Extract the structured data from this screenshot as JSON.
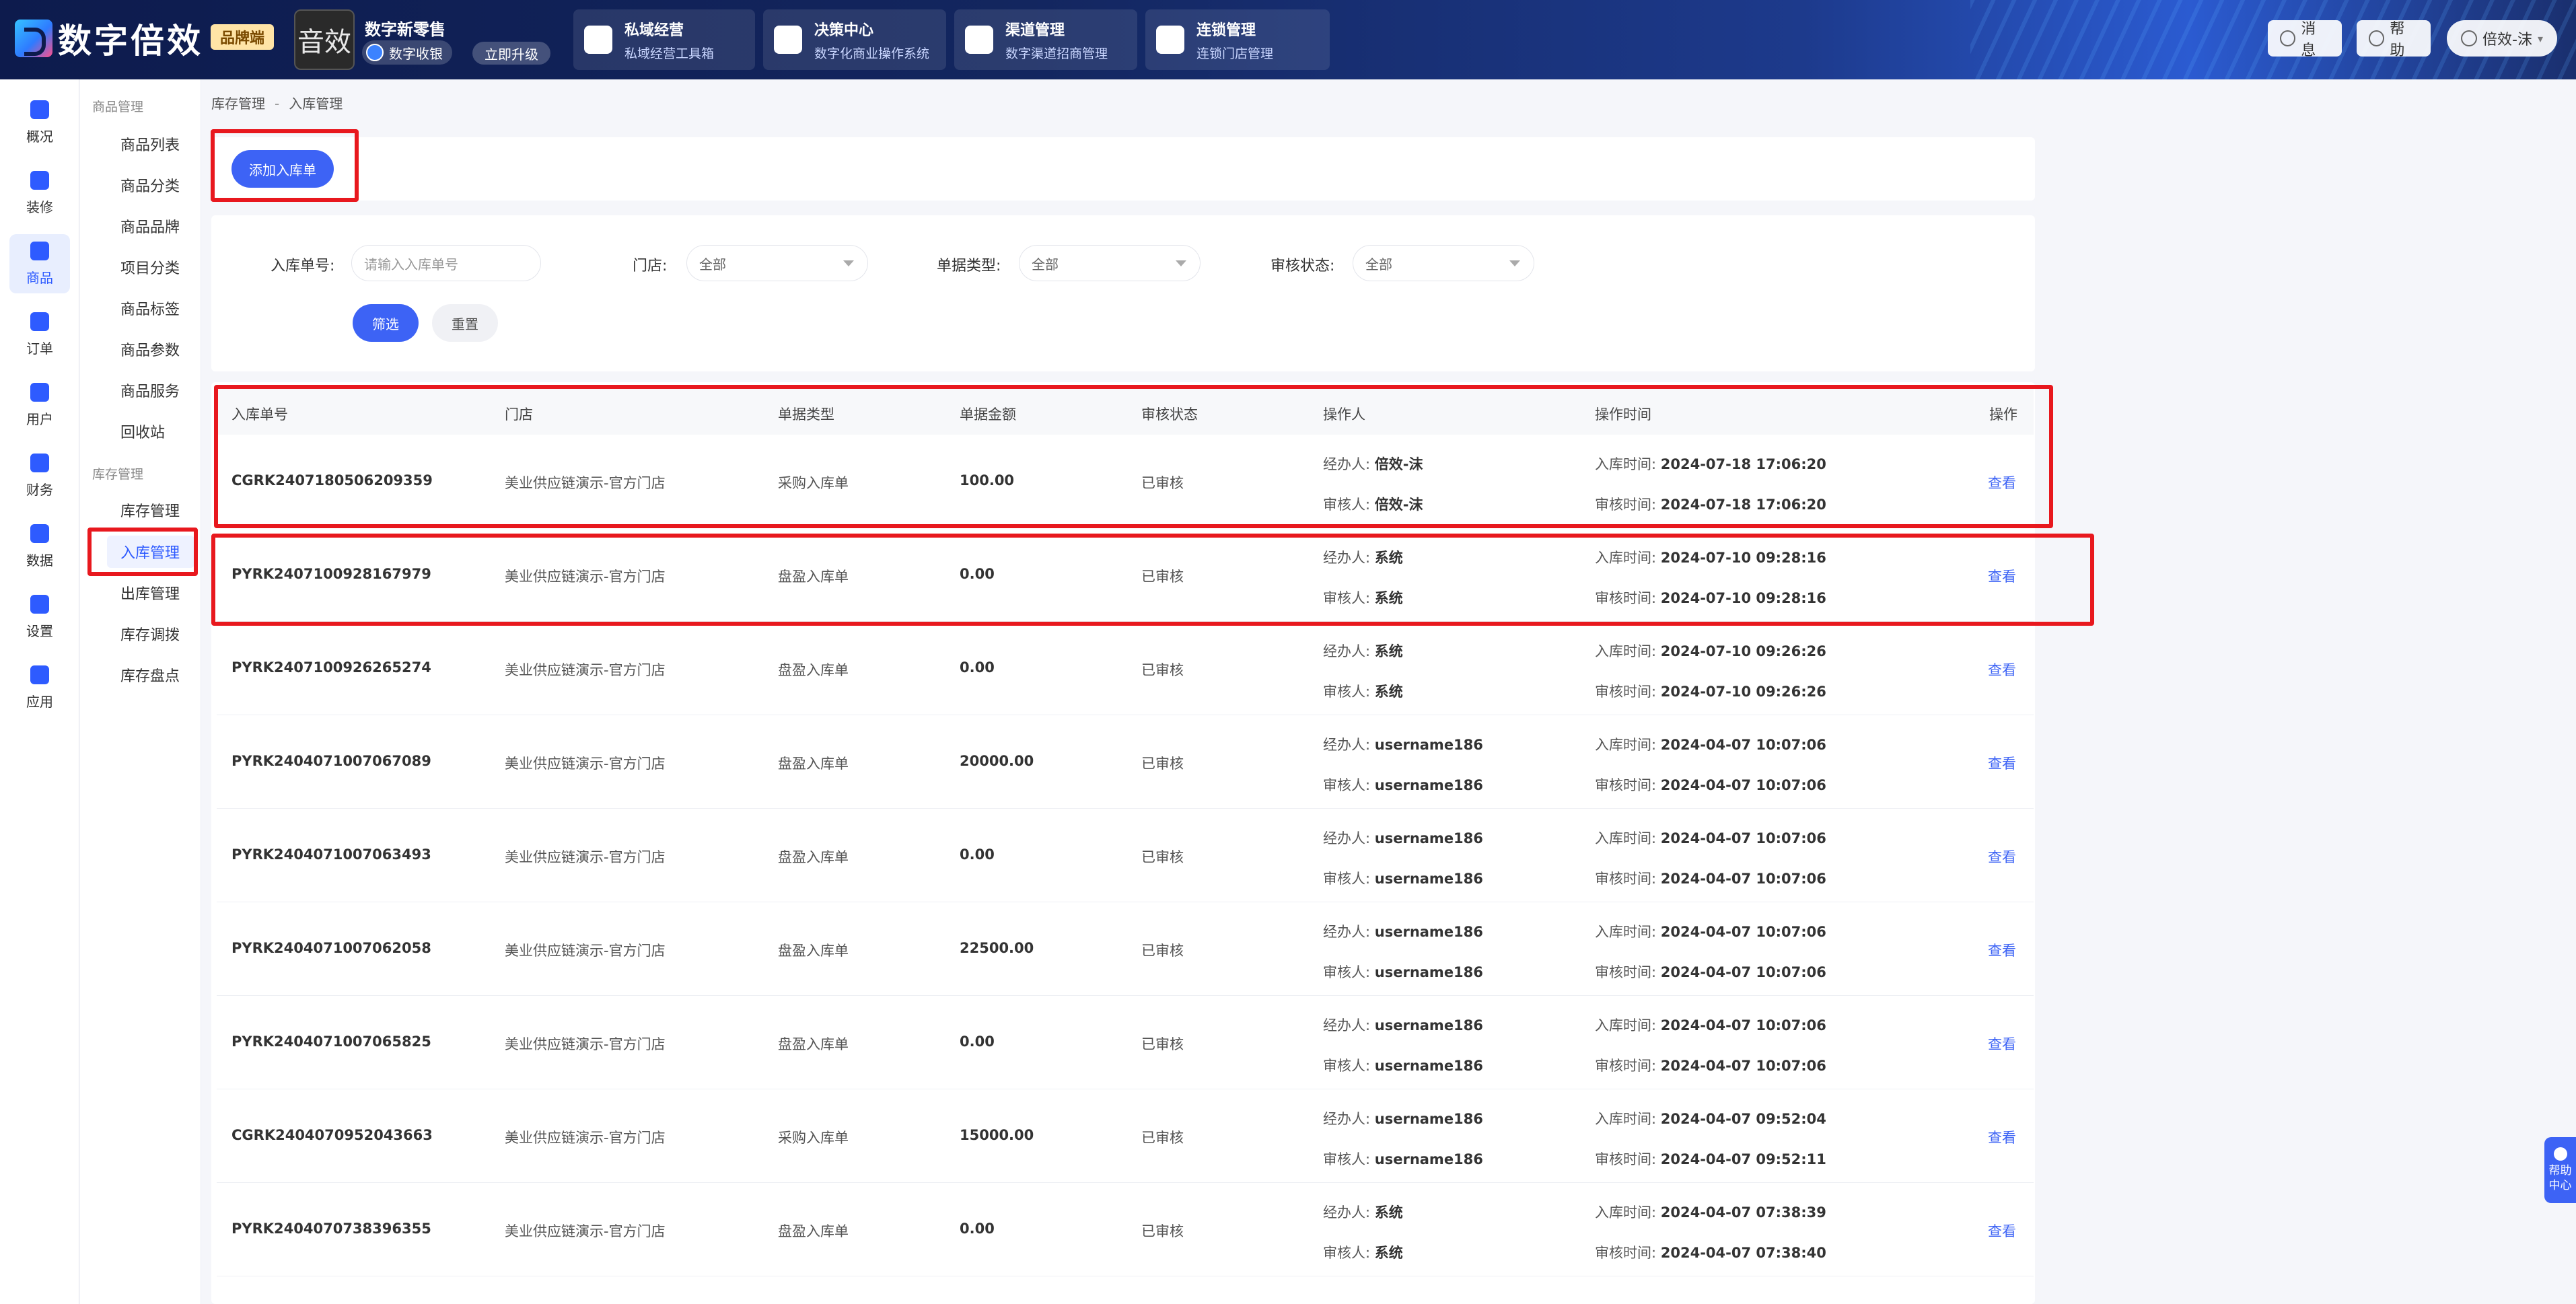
{
  "header": {
    "logo_text": "数字倍效",
    "edition": "品牌端",
    "store_avatar_text": "音效",
    "store_name": "数字新零售",
    "store_tag": "数字收银",
    "upgrade": "立即升级",
    "modules": [
      {
        "title": "私域经营",
        "sub": "私域经营工具箱"
      },
      {
        "title": "决策中心",
        "sub": "数字化商业操作系统"
      },
      {
        "title": "渠道管理",
        "sub": "数字渠道招商管理"
      },
      {
        "title": "连锁管理",
        "sub": "连锁门店管理"
      }
    ],
    "messages": "消息",
    "help": "帮助",
    "user": "倍效-沫"
  },
  "iconnav": [
    {
      "label": "概况",
      "icon": "overview-icon"
    },
    {
      "label": "装修",
      "icon": "decorate-icon"
    },
    {
      "label": "商品",
      "icon": "goods-icon"
    },
    {
      "label": "订单",
      "icon": "order-icon"
    },
    {
      "label": "用户",
      "icon": "user-icon"
    },
    {
      "label": "财务",
      "icon": "finance-icon"
    },
    {
      "label": "数据",
      "icon": "data-icon"
    },
    {
      "label": "设置",
      "icon": "settings-icon"
    },
    {
      "label": "应用",
      "icon": "apps-icon"
    }
  ],
  "subnav": {
    "group1": "商品管理",
    "items1": [
      "商品列表",
      "商品分类",
      "商品品牌",
      "项目分类",
      "商品标签",
      "商品参数",
      "商品服务",
      "回收站"
    ],
    "group2": "库存管理",
    "items2": [
      "库存管理",
      "入库管理",
      "出库管理",
      "库存调拨",
      "库存盘点"
    ]
  },
  "breadcrumb": [
    "库存管理",
    "-",
    "入库管理"
  ],
  "add_button": "添加入库单",
  "filters": {
    "order_no_label": "入库单号:",
    "order_no_placeholder": "请输入入库单号",
    "store_label": "门店:",
    "store_value": "全部",
    "type_label": "单据类型:",
    "type_value": "全部",
    "status_label": "审核状态:",
    "status_value": "全部",
    "filter_btn": "筛选",
    "reset_btn": "重置"
  },
  "table": {
    "headers": [
      "入库单号",
      "门店",
      "单据类型",
      "单据金额",
      "审核状态",
      "操作人",
      "操作时间",
      "操作"
    ],
    "handler_label": "经办人:",
    "auditor_label": "审核人:",
    "in_time_label": "入库时间:",
    "audit_time_label": "审核时间:",
    "rows": [
      {
        "no": "CGRK2407180506209359",
        "store": "美业供应链演示-官方门店",
        "type": "采购入库单",
        "amount": "100.00",
        "status": "已审核",
        "handler": "倍效-沫",
        "auditor": "倍效-沫",
        "in_time": "2024-07-18 17:06:20",
        "audit_time": "2024-07-18 17:06:20",
        "action": "查看"
      },
      {
        "no": "PYRK2407100928167979",
        "store": "美业供应链演示-官方门店",
        "type": "盘盈入库单",
        "amount": "0.00",
        "status": "已审核",
        "handler": "系统",
        "auditor": "系统",
        "in_time": "2024-07-10 09:28:16",
        "audit_time": "2024-07-10 09:28:16",
        "action": "查看"
      },
      {
        "no": "PYRK2407100926265274",
        "store": "美业供应链演示-官方门店",
        "type": "盘盈入库单",
        "amount": "0.00",
        "status": "已审核",
        "handler": "系统",
        "auditor": "系统",
        "in_time": "2024-07-10 09:26:26",
        "audit_time": "2024-07-10 09:26:26",
        "action": "查看"
      },
      {
        "no": "PYRK2404071007067089",
        "store": "美业供应链演示-官方门店",
        "type": "盘盈入库单",
        "amount": "20000.00",
        "status": "已审核",
        "handler": "username186",
        "auditor": "username186",
        "in_time": "2024-04-07 10:07:06",
        "audit_time": "2024-04-07 10:07:06",
        "action": "查看"
      },
      {
        "no": "PYRK2404071007063493",
        "store": "美业供应链演示-官方门店",
        "type": "盘盈入库单",
        "amount": "0.00",
        "status": "已审核",
        "handler": "username186",
        "auditor": "username186",
        "in_time": "2024-04-07 10:07:06",
        "audit_time": "2024-04-07 10:07:06",
        "action": "查看"
      },
      {
        "no": "PYRK2404071007062058",
        "store": "美业供应链演示-官方门店",
        "type": "盘盈入库单",
        "amount": "22500.00",
        "status": "已审核",
        "handler": "username186",
        "auditor": "username186",
        "in_time": "2024-04-07 10:07:06",
        "audit_time": "2024-04-07 10:07:06",
        "action": "查看"
      },
      {
        "no": "PYRK2404071007065825",
        "store": "美业供应链演示-官方门店",
        "type": "盘盈入库单",
        "amount": "0.00",
        "status": "已审核",
        "handler": "username186",
        "auditor": "username186",
        "in_time": "2024-04-07 10:07:06",
        "audit_time": "2024-04-07 10:07:06",
        "action": "查看"
      },
      {
        "no": "CGRK2404070952043663",
        "store": "美业供应链演示-官方门店",
        "type": "采购入库单",
        "amount": "15000.00",
        "status": "已审核",
        "handler": "username186",
        "auditor": "username186",
        "in_time": "2024-04-07 09:52:04",
        "audit_time": "2024-04-07 09:52:11",
        "action": "查看"
      },
      {
        "no": "PYRK2404070738396355",
        "store": "美业供应链演示-官方门店",
        "type": "盘盈入库单",
        "amount": "0.00",
        "status": "已审核",
        "handler": "系统",
        "auditor": "系统",
        "in_time": "2024-04-07 07:38:39",
        "audit_time": "2024-04-07 07:38:40",
        "action": "查看"
      }
    ]
  },
  "help_float": "帮助中心",
  "colors": {
    "accent": "#3d63f5",
    "highlight": "#e8181e"
  }
}
